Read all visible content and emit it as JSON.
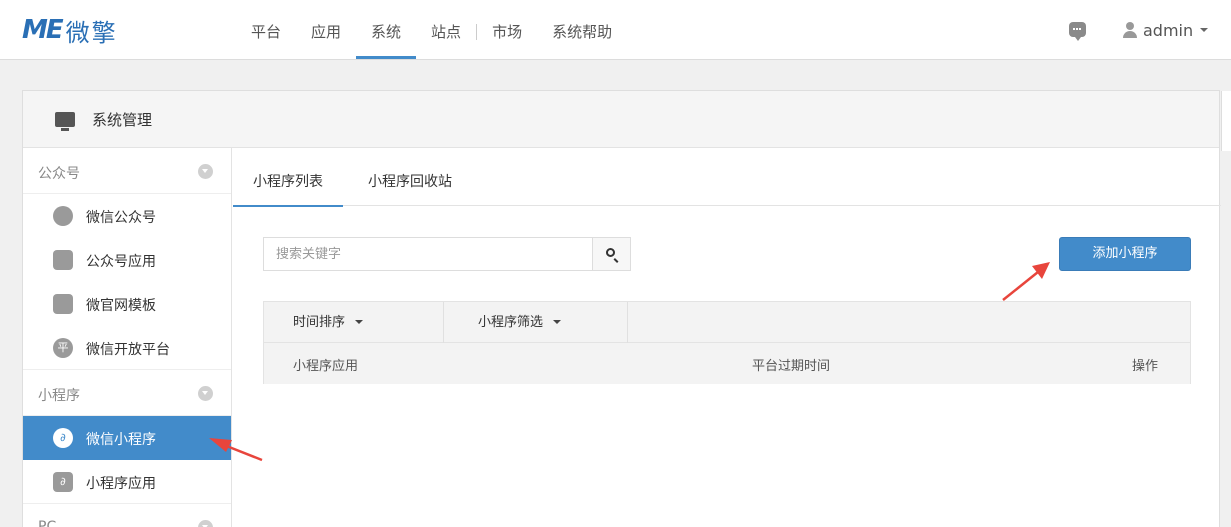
{
  "brand": {
    "mark": "ME",
    "name": "微擎"
  },
  "nav": [
    {
      "label": "平台"
    },
    {
      "label": "应用"
    },
    {
      "label": "系统"
    },
    {
      "label": "站点"
    },
    {
      "label": "市场"
    },
    {
      "label": "系统帮助"
    }
  ],
  "user": {
    "name": "admin"
  },
  "panel": {
    "title": "系统管理"
  },
  "sidebar": {
    "groups": [
      {
        "label": "公众号",
        "items": [
          {
            "label": "微信公众号",
            "icon": "wechat-icon"
          },
          {
            "label": "公众号应用",
            "icon": "account-app-icon"
          },
          {
            "label": "微官网模板",
            "icon": "template-icon"
          },
          {
            "label": "微信开放平台",
            "icon": "open-platform-icon",
            "glyph": "平"
          }
        ]
      },
      {
        "label": "小程序",
        "items": [
          {
            "label": "微信小程序",
            "icon": "mini-program-icon",
            "active": true
          },
          {
            "label": "小程序应用",
            "icon": "mini-program-app-icon"
          }
        ]
      }
    ],
    "next_group_label": "PC"
  },
  "tabs": [
    {
      "label": "小程序列表",
      "active": true
    },
    {
      "label": "小程序回收站"
    }
  ],
  "search": {
    "placeholder": "搜索关键字"
  },
  "add_button": {
    "label": "添加小程序"
  },
  "filters": [
    {
      "label": "时间排序"
    },
    {
      "label": "小程序筛选"
    }
  ],
  "table_headers": {
    "app": "小程序应用",
    "expire": "平台过期时间",
    "actions": "操作"
  },
  "colors": {
    "accent": "#428bca",
    "annotation": "#e8453c"
  }
}
